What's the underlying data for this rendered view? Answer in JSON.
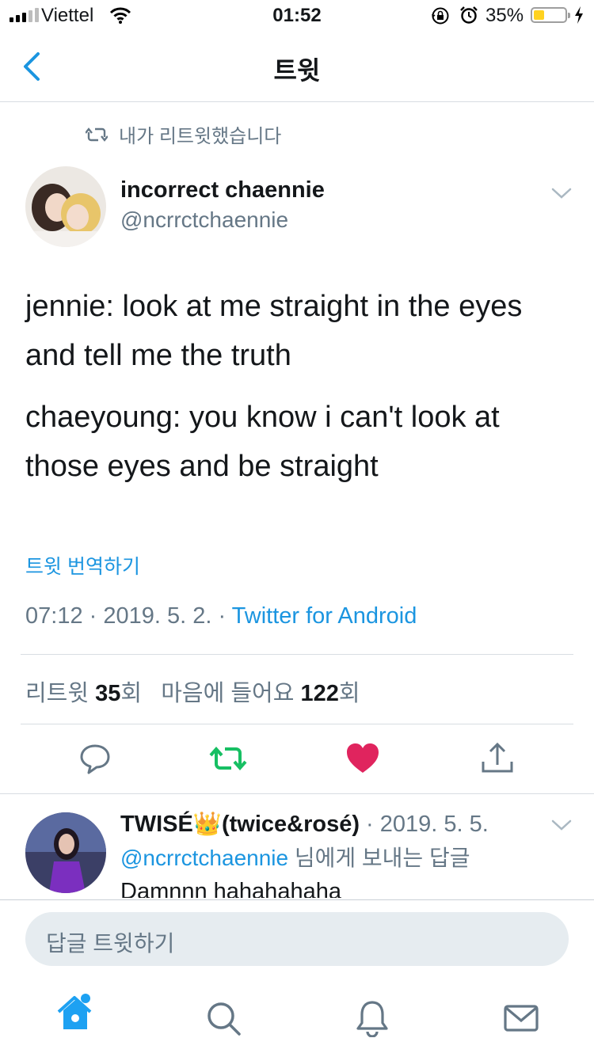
{
  "status_bar": {
    "carrier": "Viettel",
    "time": "01:52",
    "battery_percent": "35%",
    "battery_level": 0.35,
    "battery_color": "#ffd21f"
  },
  "nav": {
    "title": "트윗",
    "back_icon": "chevron-left-icon"
  },
  "retweet_context": {
    "icon": "retweet-icon",
    "text": "내가 리트윗했습니다"
  },
  "tweet": {
    "author_name": "incorrect chaennie",
    "author_handle": "@ncrrctchaennie",
    "lines": [
      "jennie: look at me straight in the eyes and tell me the truth",
      "chaeyoung: you know i can't look at those eyes and be straight"
    ],
    "translate_link": "트윗 번역하기",
    "meta_prefix": "07:12 · 2019. 5. 2. · ",
    "source": "Twitter for Android",
    "stats": {
      "retweet_label": "리트윗",
      "retweet_count": "35",
      "retweet_suffix": "회",
      "like_label": "마음에 들어요",
      "like_count": "122",
      "like_suffix": "회"
    },
    "actions": [
      "reply-icon",
      "retweet-icon",
      "like-icon",
      "share-icon"
    ],
    "accent_colors": {
      "retweet": "#17bf63",
      "like": "#e0245e",
      "link": "#1b95e0",
      "secondary": "#657786"
    }
  },
  "reply": {
    "name": "TWISÉ",
    "crown": "👑",
    "name_suffix": "(twice&rosé)",
    "date": " · 2019. 5. 5.",
    "mention": "@ncrrctchaennie",
    "mention_suffix": " 님에게 보내는 답글",
    "text": "Damnnn hahahahaha"
  },
  "composer": {
    "placeholder": "답글 트윗하기"
  },
  "tabs": [
    "home-icon",
    "search-icon",
    "notifications-icon",
    "messages-icon"
  ]
}
